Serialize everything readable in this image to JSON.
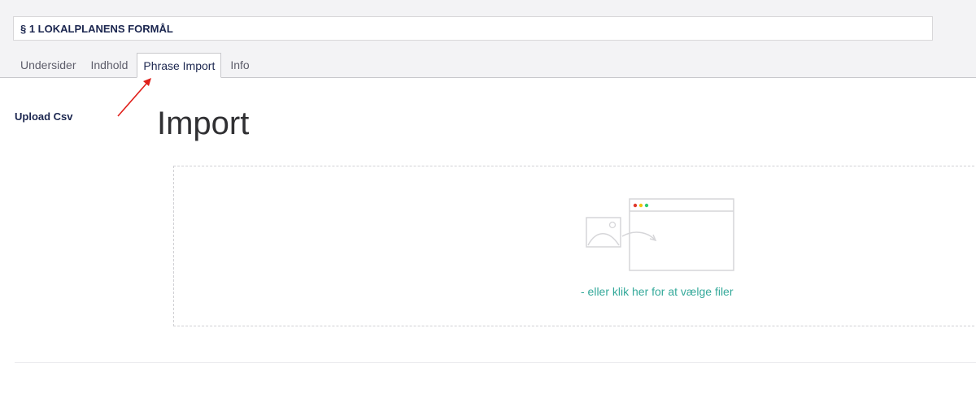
{
  "header": {
    "node_name": "§ 1 LOKALPLANENS FORMÅL"
  },
  "tabs": [
    {
      "label": "Undersider",
      "active": false
    },
    {
      "label": "Indhold",
      "active": false
    },
    {
      "label": "Phrase Import",
      "active": true
    },
    {
      "label": "Info",
      "active": false
    }
  ],
  "property": {
    "label": "Upload Csv"
  },
  "importer": {
    "title": "Import",
    "pick_files_link": "- eller klik her for at vælge filer",
    "illustration": "drag-file-to-window-icon"
  },
  "annotation": {
    "type": "red-arrow",
    "points_to": "Phrase Import tab",
    "color": "#e0201b"
  },
  "colors": {
    "accent_link": "#34a99a",
    "title_text": "#1b264f",
    "window_dots": [
      "#e0392c",
      "#f1c40f",
      "#2ecc71"
    ]
  }
}
